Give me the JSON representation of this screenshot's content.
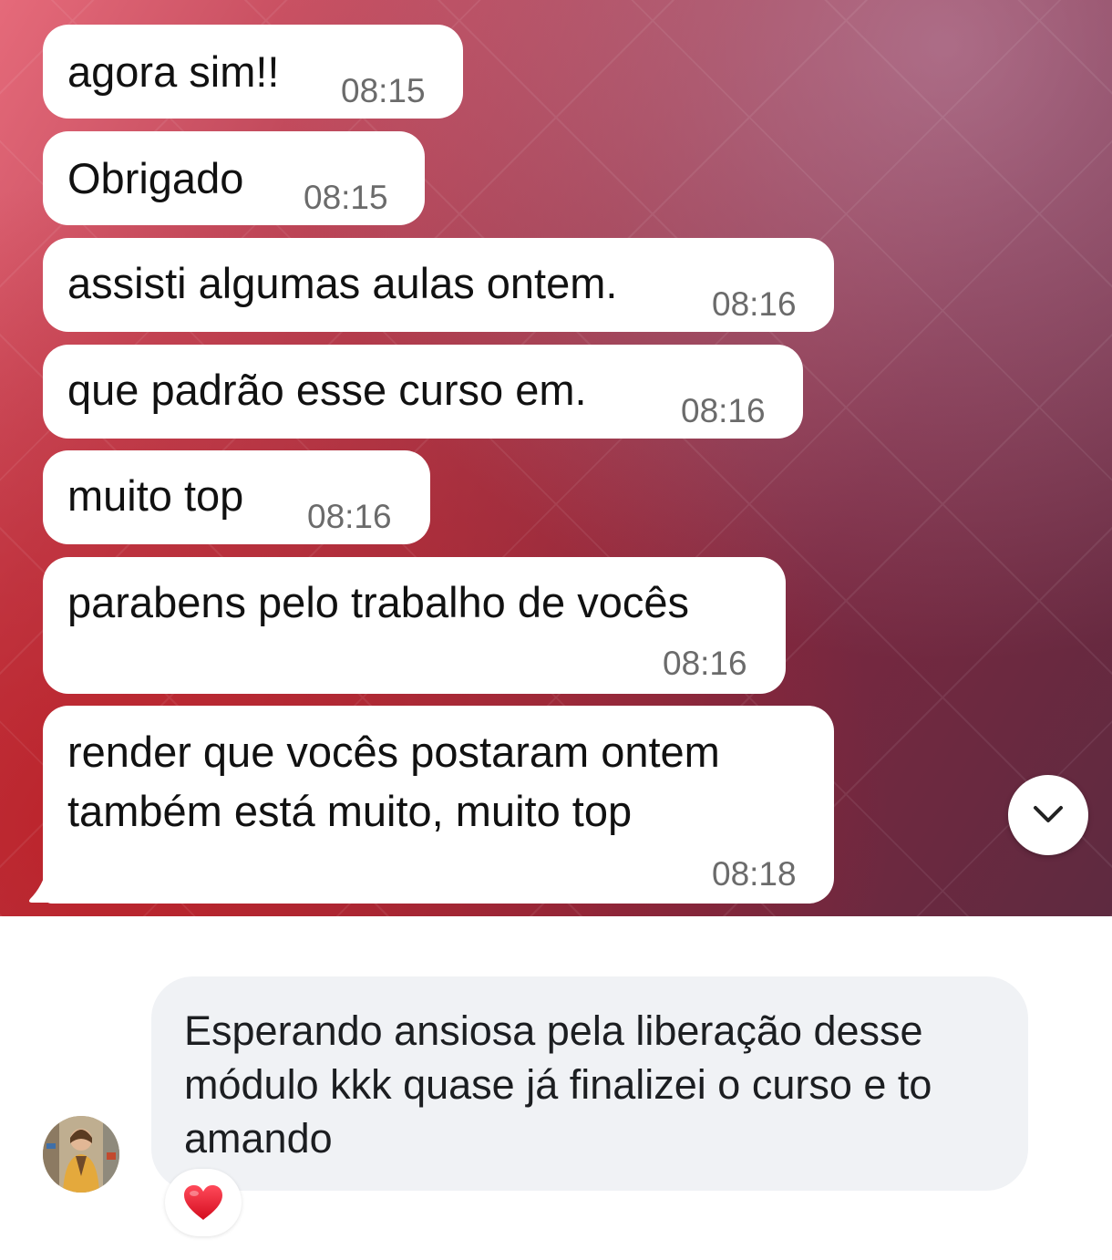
{
  "messages": [
    {
      "text": "agora sim!!",
      "time": "08:15"
    },
    {
      "text": "Obrigado",
      "time": "08:15"
    },
    {
      "text": "assisti algumas aulas ontem.",
      "time": "08:16"
    },
    {
      "text": "que padrão esse curso em.",
      "time": "08:16"
    },
    {
      "text": "muito top",
      "time": "08:16"
    },
    {
      "text": "parabens pelo trabalho de vocês",
      "time": "08:16"
    },
    {
      "lines": [
        "render que vocês postaram ontem",
        "também está muito, muito top"
      ],
      "time": "08:18"
    }
  ],
  "scroll_button": {
    "icon": "chevron-down-icon"
  },
  "comment": {
    "avatar_icon": "avatar",
    "lines": [
      "Esperando ansiosa pela liberação desse",
      "módulo kkk quase já finalizei o curso e to",
      "amando"
    ],
    "reaction": {
      "icon": "heart-icon",
      "color": "#e8132a"
    }
  },
  "colors": {
    "bubble_bg": "#ffffff",
    "comment_bg": "#f0f2f5",
    "time_text": "#6b6b6b"
  }
}
